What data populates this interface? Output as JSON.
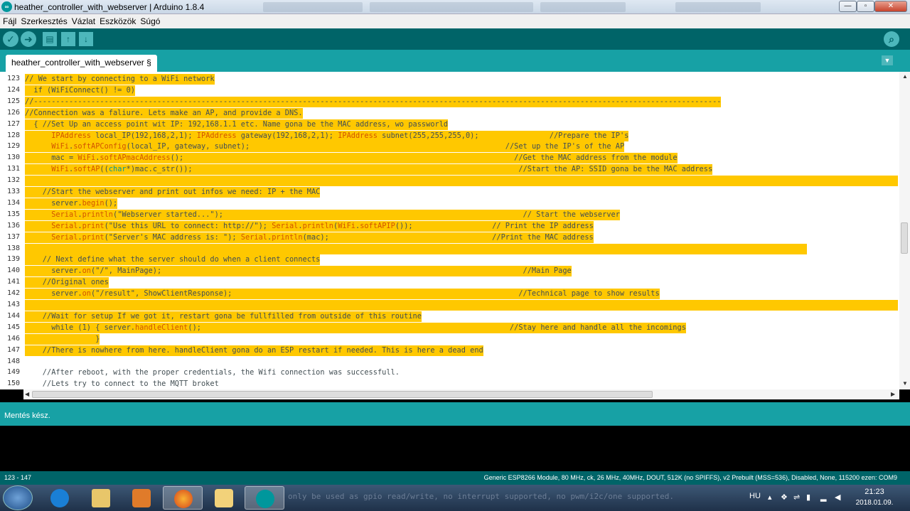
{
  "window": {
    "title": "heather_controller_with_webserver | Arduino 1.8.4",
    "logo_text": "∞",
    "buttons": {
      "minimize": "—",
      "maximize": "▫",
      "close": "✕"
    }
  },
  "menu": [
    "Fájl",
    "Szerkesztés",
    "Vázlat",
    "Eszközök",
    "Súgó"
  ],
  "toolbar": {
    "verify": "✓",
    "upload": "➜",
    "new": "▤",
    "open": "↑",
    "save": "↓",
    "serial_monitor": "⌕"
  },
  "tab": {
    "label": "heather_controller_with_webserver §",
    "menu_glyph": "▼"
  },
  "editor": {
    "lines": [
      {
        "n": "123",
        "hl": true,
        "html": "// We start by connecting to a WiFi network"
      },
      {
        "n": "124",
        "hl": true,
        "html": "  if (WiFiConnect() != 0)"
      },
      {
        "n": "125",
        "hl": true,
        "html": "//------------------------------------------------------------------------------------------------------------------------------------------------------------"
      },
      {
        "n": "126",
        "hl": true,
        "html": "//Connection was a faliure. Lets make an AP, and provide a DNS."
      },
      {
        "n": "127",
        "hl": true,
        "html": "  { //Set Up an access point wit IP: 192,168.1.1 etc. Name gona be the MAC address, wo passworld"
      },
      {
        "n": "128",
        "hl": true,
        "html": "      <span class=\"kw\">IPAddress</span> local_IP(192,168,2,1); <span class=\"kw\">IPAddress</span> gateway(192,168,2,1); <span class=\"kw\">IPAddress</span> subnet(255,255,255,0);                //Prepare the IP's"
      },
      {
        "n": "129",
        "hl": true,
        "html": "      <span class=\"kw\">WiFi</span>.<span class=\"kw\">softAPConfig</span>(local_IP, gateway, subnet);                                                          //Set up the IP's of the AP"
      },
      {
        "n": "130",
        "hl": true,
        "html": "      mac = <span class=\"kw\">WiFi</span>.<span class=\"kw\">softAPmacAddress</span>();                                                                           //Get the MAC address from the module"
      },
      {
        "n": "131",
        "hl": true,
        "html": "      <span class=\"kw\">WiFi</span>.<span class=\"kw\">softAP</span>((<span class=\"ty\">char</span>*)mac.c_str());                                                                          //Start the AP: SSID gona be the MAC address"
      },
      {
        "n": "132",
        "hl": true,
        "html": " "
      },
      {
        "n": "133",
        "hl": true,
        "html": "    //Start the webserver and print out infos we need: IP + the MAC"
      },
      {
        "n": "134",
        "hl": true,
        "html": "      server.<span class=\"kw\">begin</span>();"
      },
      {
        "n": "135",
        "hl": true,
        "html": "      <span class=\"kw\">Serial</span>.<span class=\"kw\">println</span>(\"Webserver started...\");                                                                    // Start the webserver"
      },
      {
        "n": "136",
        "hl": true,
        "html": "      <span class=\"kw\">Serial</span>.<span class=\"kw\">print</span>(\"Use this URL to connect: http://\"); <span class=\"kw\">Serial</span>.<span class=\"kw\">println</span>(<span class=\"kw\">WiFi</span>.<span class=\"kw\">softAPIP</span>());                  // Print the IP address"
      },
      {
        "n": "137",
        "hl": true,
        "html": "      <span class=\"kw\">Serial</span>.<span class=\"kw\">print</span>(\"Server's MAC address is: \"); <span class=\"kw\">Serial</span>.<span class=\"kw\">println</span>(mac);                                     //Print the MAC address"
      },
      {
        "n": "138",
        "hl": true,
        "html": "    "
      },
      {
        "n": "139",
        "hl": true,
        "html": "    // Next define what the server should do when a client connects"
      },
      {
        "n": "140",
        "hl": true,
        "html": "      server.<span class=\"kw\">on</span>(\"/\", MainPage);                                                                                  //Main Page"
      },
      {
        "n": "141",
        "hl": true,
        "html": "    //Original ones"
      },
      {
        "n": "142",
        "hl": true,
        "html": "      server.<span class=\"kw\">on</span>(\"/result\", ShowClientResponse);                                                                 //Technical page to show results"
      },
      {
        "n": "143",
        "hl": true,
        "html": " "
      },
      {
        "n": "144",
        "hl": true,
        "html": "    //Wait for setup If we got it, restart gona be fullfilled from outside of this routine"
      },
      {
        "n": "145",
        "hl": true,
        "html": "      while (1) { server.<span class=\"kw\">handleClient</span>();                                                                      //Stay here and handle all the incomings"
      },
      {
        "n": "146",
        "hl": true,
        "html": "                }"
      },
      {
        "n": "147",
        "hl": true,
        "html": "    //There is nowhere from here. handleClient gona do an ESP restart if needed. This is here a dead end"
      },
      {
        "n": "148",
        "hl": false,
        "html": ""
      },
      {
        "n": "149",
        "hl": false,
        "html": "    //After reboot, with the proper credentials, the Wifi connection was successfull."
      },
      {
        "n": "150",
        "hl": false,
        "html": "    //Lets try to connect to the MQTT broket"
      }
    ]
  },
  "status": {
    "message": "Mentés kész."
  },
  "bottom": {
    "lines": "123 - 147",
    "board": "Generic ESP8266 Module, 80 MHz, ck, 26 MHz, 40MHz, DOUT, 512K (no SPIFFS), v2 Prebuilt (MSS=536), Disabled, None, 115200 ezen: COM9"
  },
  "taskbar": {
    "ghost_text": "only be used as gpio read/write, no interrupt supported, no pwm/i2c/one supported.",
    "apps": [
      "start",
      "internet-explorer",
      "file-explorer",
      "media-player",
      "firefox",
      "outlook",
      "arduino"
    ],
    "lang": "HU",
    "time": "21:23",
    "date": "2018.01.09."
  },
  "colors": {
    "teal_dark": "#006468",
    "teal": "#17a1a5",
    "selection": "#ffc800",
    "keyword": "#d35400"
  }
}
